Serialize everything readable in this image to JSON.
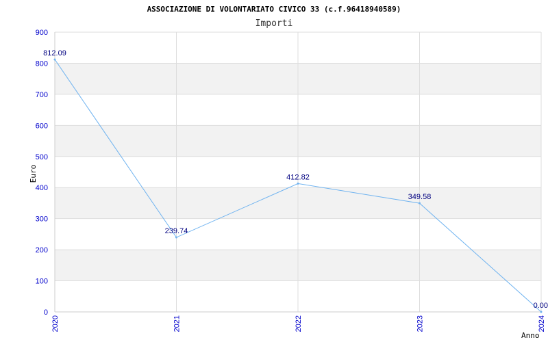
{
  "chart_data": {
    "type": "line",
    "title": "ASSOCIAZIONE DI VOLONTARIATO CIVICO 33 (c.f.96418940589)",
    "subtitle": "Importi",
    "xlabel": "Anno",
    "ylabel": "Euro",
    "categories": [
      "2020",
      "2021",
      "2022",
      "2023",
      "2024"
    ],
    "series": [
      {
        "values": [
          812.09,
          239.74,
          412.82,
          349.58,
          0.0
        ],
        "labels": [
          "812.09",
          "239.74",
          "412.82",
          "349.58",
          "0.00"
        ]
      }
    ],
    "ylim": [
      0,
      900
    ],
    "yticks": [
      "0",
      "100",
      "200",
      "300",
      "400",
      "500",
      "600",
      "700",
      "800",
      "900"
    ],
    "grid": true,
    "colors": {
      "line": "#6fb3f0",
      "band": "#f2f2f2",
      "grid": "#dddddd",
      "tick_text": "#0000cc",
      "label_text": "#000080"
    }
  }
}
